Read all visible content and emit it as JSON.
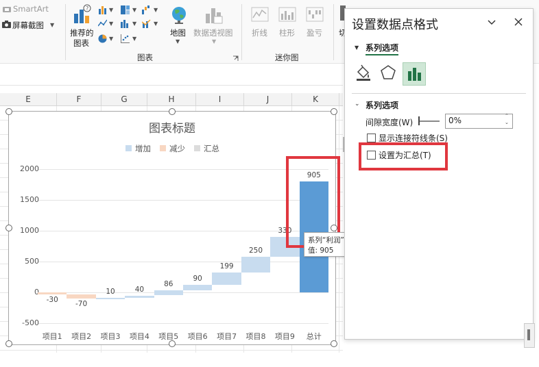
{
  "ribbon": {
    "smartart": "SmartArt",
    "screenshot": "屏幕截图",
    "recommended_charts": [
      "推荐的",
      "图表"
    ],
    "map": "地图",
    "pivot_chart": "数据透视图",
    "line": "折线",
    "column": "柱形",
    "winloss": "盈亏",
    "partial_letter": "切",
    "group_charts": "图表",
    "group_sparklines": "迷你图"
  },
  "columns": [
    "E",
    "F",
    "G",
    "H",
    "I",
    "J",
    "K"
  ],
  "chart_data": {
    "type": "bar",
    "subtype": "waterfall",
    "title": "图表标题",
    "legend": [
      "增加",
      "减少",
      "汇总"
    ],
    "legend_position": "top",
    "categories": [
      "项目1",
      "项目2",
      "项目3",
      "项目4",
      "项目5",
      "项目6",
      "项目7",
      "项目8",
      "项目9",
      "总计"
    ],
    "values": [
      -30,
      -70,
      10,
      40,
      86,
      90,
      199,
      250,
      330,
      905
    ],
    "labels": [
      "-30",
      "-70",
      "10",
      "40",
      "86",
      "90",
      "199",
      "250",
      "330",
      "905"
    ],
    "total_bar_display_value": 1800,
    "ylim": [
      -500,
      2000
    ],
    "yticks": [
      "2000",
      "1500",
      "1000",
      "500",
      "0",
      "-500"
    ],
    "grid": true,
    "colors": {
      "increase": "#c8dcef",
      "decrease": "#f8d7c2",
      "total": "#dcdcdc",
      "selected": "#5b9bd5"
    }
  },
  "tooltip": {
    "line1": "系列“利润” 点“总计”",
    "line2": "值: 905"
  },
  "pane": {
    "title": "设置数据点格式",
    "series_options_dropdown": "系列选项",
    "section_title": "系列选项",
    "gap_width_label": "间隙宽度(W)",
    "gap_width_value": "0%",
    "show_connector_label": "显示连接符线条(S)",
    "set_as_total_label": "设置为汇总(T)",
    "show_connector_checked": false,
    "set_as_total_checked": false,
    "active_tab": "series-options",
    "accent": "#217346",
    "highlight": "#e0373f"
  }
}
